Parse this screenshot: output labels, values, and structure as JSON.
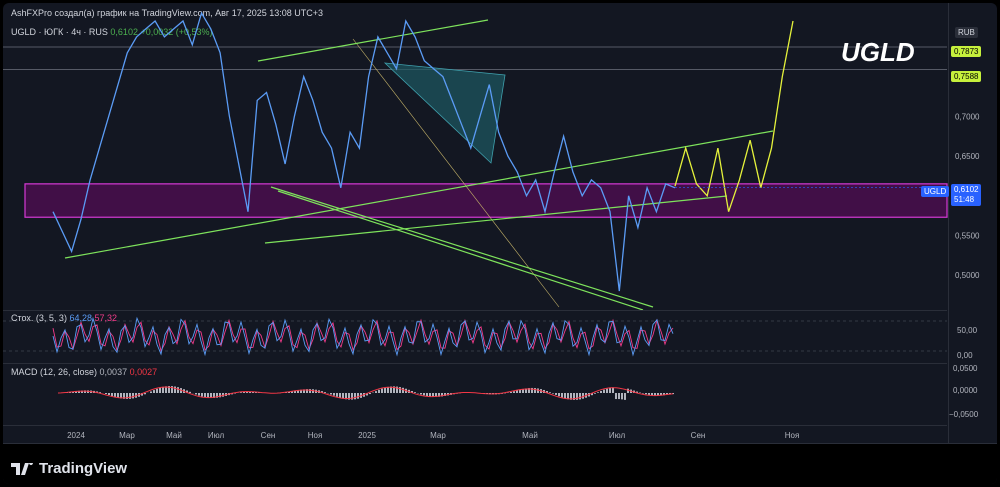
{
  "header": {
    "caption": "AshFXPro создал(а) график на TradingView.com, Авг 17, 2025 13:08 UTC+3"
  },
  "symbol": {
    "legend_name": "UGLD · ЮГК · 4ч · RUS",
    "last": "0,6102",
    "change": "+0,0032 (+0,53%)",
    "title": "UGLD",
    "currency": "RUB",
    "price_tag_label": "UGLD",
    "price_tag_value": "0,6102",
    "countdown": "51:48"
  },
  "levels": [
    {
      "label": "0,7873",
      "value": 0.7873
    },
    {
      "label": "0,7588",
      "value": 0.7588
    }
  ],
  "colors": {
    "price_line": "#5b9cf6",
    "trend_green": "#7ee35c",
    "zone_fill": "#4a0e4e",
    "zone_border": "#d63ad6",
    "projection": "#e5f23b",
    "triangle_fill": "#1e5a63",
    "stoch_k": "#5b9cf6",
    "stoch_d": "#f23b8a",
    "macd": "#f23645",
    "hist": "#b2b5be"
  },
  "stoch": {
    "title": "Стох. (3, 5, 3)",
    "k": "64,28",
    "d": "57,32",
    "ticks": [
      "50,00",
      "0,00"
    ]
  },
  "macd": {
    "title": "MACD (12, 26, close)",
    "v1": "0,0037",
    "v2": "0,0027",
    "ticks": [
      "0,0500",
      "0,0000",
      "−0,0500"
    ]
  },
  "chart_data": {
    "type": "line",
    "title": "UGLD",
    "ylim": [
      0.46,
      0.82
    ],
    "y_ticks": [
      "0,7500",
      "0,7000",
      "0,6500",
      "0,5500",
      "0,5000"
    ],
    "x_ticks": [
      "2024",
      "Мар",
      "Май",
      "Июл",
      "Сен",
      "Ноя",
      "2025",
      "Мар",
      "Май",
      "Июл",
      "Сен",
      "Ноя"
    ],
    "zone": [
      0.573,
      0.615
    ],
    "series": [
      {
        "values": [
          0.58,
          0.555,
          0.53,
          0.57,
          0.62,
          0.66,
          0.7,
          0.74,
          0.78,
          0.8,
          0.81,
          0.82,
          0.8,
          0.81,
          0.82,
          0.79,
          0.83,
          0.81,
          0.78,
          0.7,
          0.64,
          0.58,
          0.72,
          0.73,
          0.69,
          0.64,
          0.7,
          0.75,
          0.72,
          0.68,
          0.66,
          0.61,
          0.68,
          0.66,
          0.75,
          0.8,
          0.78,
          0.76,
          0.82,
          0.8,
          0.77,
          0.76,
          0.75,
          0.72,
          0.69,
          0.66,
          0.7,
          0.74,
          0.68,
          0.65,
          0.63,
          0.6,
          0.62,
          0.58,
          0.63,
          0.675,
          0.63,
          0.6,
          0.62,
          0.61,
          0.58,
          0.48,
          0.6,
          0.56,
          0.61,
          0.58,
          0.615,
          0.61
        ]
      },
      {
        "values": [
          0.612,
          0.66,
          0.615,
          0.6,
          0.66,
          0.58,
          0.62,
          0.67,
          0.61,
          0.66,
          0.75,
          0.82
        ]
      }
    ]
  }
}
